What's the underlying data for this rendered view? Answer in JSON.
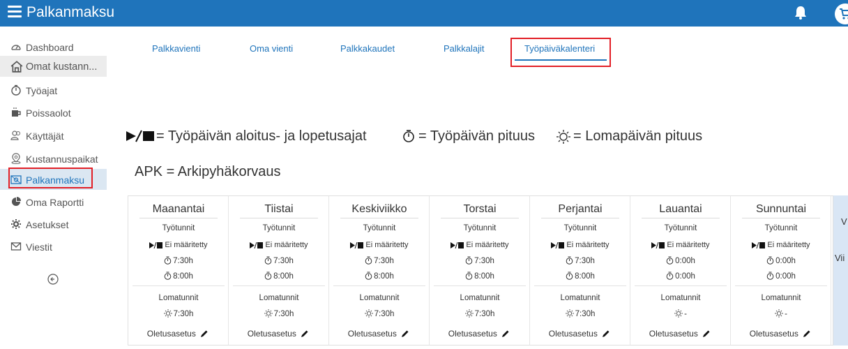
{
  "app": {
    "title": "Palkanmaksu"
  },
  "sidebar": {
    "items": [
      {
        "label": "Dashboard",
        "icon": "dashboard-icon"
      },
      {
        "label": "Omat kustann...",
        "icon": "home-icon"
      },
      {
        "label": "Työajat",
        "icon": "stopwatch-icon"
      },
      {
        "label": "Poissaolot",
        "icon": "coffee-icon"
      },
      {
        "label": "Käyttäjät",
        "icon": "users-icon"
      },
      {
        "label": "Kustannuspaikat",
        "icon": "location-pin-icon"
      },
      {
        "label": "Palkanmaksu",
        "icon": "payroll-icon"
      },
      {
        "label": "Oma Raportti",
        "icon": "pie-chart-icon"
      },
      {
        "label": "Asetukset",
        "icon": "gear-icon"
      },
      {
        "label": "Viestit",
        "icon": "mail-icon"
      }
    ]
  },
  "tabs": [
    {
      "label": "Palkkavienti"
    },
    {
      "label": "Oma vienti"
    },
    {
      "label": "Palkkakaudet"
    },
    {
      "label": "Palkkalajit"
    },
    {
      "label": "Työpäiväkalenteri"
    }
  ],
  "legend": {
    "start_end": "= Työpäivän aloitus- ja lopetusajat",
    "length": "= Työpäivän pituus",
    "holiday": "= Lomapäivän pituus",
    "apk": "APK = Arkipyhäkorvaus"
  },
  "days": [
    {
      "name": "Maanantai",
      "work_label": "Työtunnit",
      "times": "Ei määritetty",
      "length": "7:30h",
      "length2": "8:00h",
      "holiday_label": "Lomatunnit",
      "holiday": "7:30h",
      "default": "Oletusasetus"
    },
    {
      "name": "Tiistai",
      "work_label": "Työtunnit",
      "times": "Ei määritetty",
      "length": "7:30h",
      "length2": "8:00h",
      "holiday_label": "Lomatunnit",
      "holiday": "7:30h",
      "default": "Oletusasetus"
    },
    {
      "name": "Keskiviikko",
      "work_label": "Työtunnit",
      "times": "Ei määritetty",
      "length": "7:30h",
      "length2": "8:00h",
      "holiday_label": "Lomatunnit",
      "holiday": "7:30h",
      "default": "Oletusasetus"
    },
    {
      "name": "Torstai",
      "work_label": "Työtunnit",
      "times": "Ei määritetty",
      "length": "7:30h",
      "length2": "8:00h",
      "holiday_label": "Lomatunnit",
      "holiday": "7:30h",
      "default": "Oletusasetus"
    },
    {
      "name": "Perjantai",
      "work_label": "Työtunnit",
      "times": "Ei määritetty",
      "length": "7:30h",
      "length2": "8:00h",
      "holiday_label": "Lomatunnit",
      "holiday": "7:30h",
      "default": "Oletusasetus"
    },
    {
      "name": "Lauantai",
      "work_label": "Työtunnit",
      "times": "Ei määritetty",
      "length": "0:00h",
      "length2": "0:00h",
      "holiday_label": "Lomatunnit",
      "holiday": "-",
      "default": "Oletusasetus"
    },
    {
      "name": "Sunnuntai",
      "work_label": "Työtunnit",
      "times": "Ei määritetty",
      "length": "0:00h",
      "length2": "0:00h",
      "holiday_label": "Lomatunnit",
      "holiday": "-",
      "default": "Oletusasetus"
    }
  ],
  "extra_panel": {
    "line1": "V",
    "line2": "Vii"
  },
  "colors": {
    "brand": "#1f74bb",
    "highlight": "#e21f26",
    "active_bg": "#dbe7f2"
  }
}
